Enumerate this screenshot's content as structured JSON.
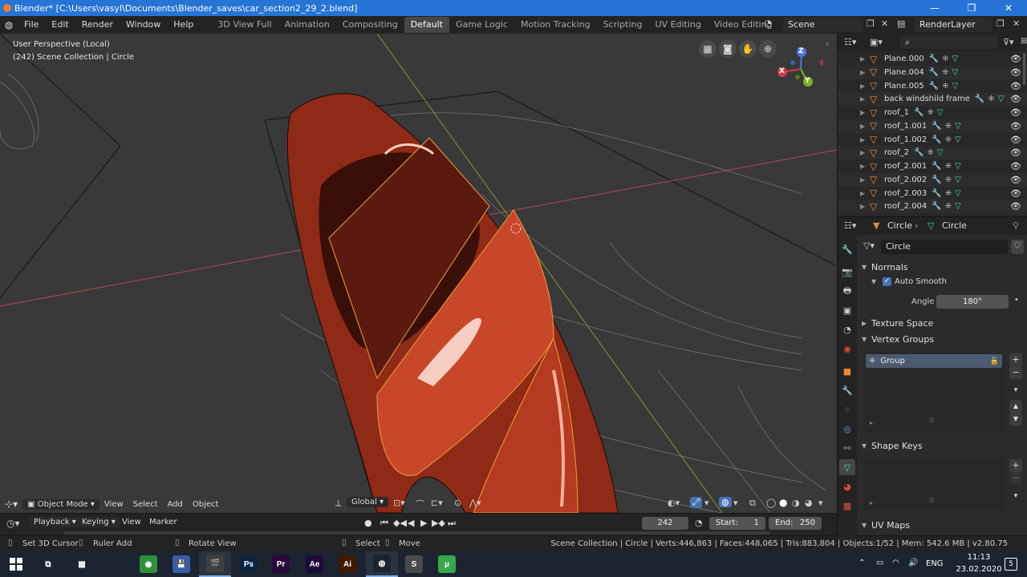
{
  "window": {
    "title": "Blender* [C:\\Users\\vasyl\\Documents\\Blender_saves\\car_section2_29_2.blend]",
    "min_glyph": "—",
    "max_glyph": "❐",
    "close_glyph": "✕"
  },
  "menu": {
    "items": [
      "File",
      "Edit",
      "Render",
      "Window",
      "Help"
    ]
  },
  "workspaces": {
    "tabs": [
      "3D View Full",
      "Animation",
      "Compositing",
      "Default",
      "Game Logic",
      "Motion Tracking",
      "Scripting",
      "UV Editing",
      "Video Editing"
    ],
    "active": "Default",
    "add_glyph": "+"
  },
  "scene": {
    "name": "Scene",
    "render_layer": "RenderLayer"
  },
  "viewport": {
    "perspective": "User Perspective (Local)",
    "collection_info": "(242) Scene Collection | Circle",
    "gizmo": {
      "x": "X",
      "y": "Y",
      "z": "Z"
    }
  },
  "viewport_header": {
    "mode": "Object Mode",
    "menus": [
      "View",
      "Select",
      "Add",
      "Object"
    ],
    "orientation": "Global"
  },
  "timeline": {
    "menus": [
      "Playback",
      "Keying",
      "View",
      "Marker"
    ],
    "current_frame": "242",
    "start_label": "Start:",
    "start": "1",
    "end_label": "End:",
    "end": "250"
  },
  "statusbar": {
    "hints": [
      "Set 3D Cursor",
      "Ruler Add",
      "Rotate View",
      "Select",
      "Move"
    ],
    "stats": "Scene Collection | Circle | Verts:446,863 | Faces:448,065 | Tris:883,804 | Objects:1/52 | Mem: 542.6 MB | v2.80.75"
  },
  "outliner": {
    "search_placeholder": "",
    "items": [
      {
        "name": "Plane.000",
        "mesh_data": true
      },
      {
        "name": "Plane.004",
        "mesh_data": true
      },
      {
        "name": "Plane.005",
        "mesh_data": true
      },
      {
        "name": "back windshild frame",
        "mesh_data": true
      },
      {
        "name": "roof_1",
        "mesh_data": false
      },
      {
        "name": "roof_1.001",
        "mesh_data": false
      },
      {
        "name": "roof_1.002",
        "mesh_data": true
      },
      {
        "name": "roof_2",
        "mesh_data": false
      },
      {
        "name": "roof_2.001",
        "mesh_data": true
      },
      {
        "name": "roof_2.002",
        "mesh_data": true
      },
      {
        "name": "roof_2.003",
        "mesh_data": true
      },
      {
        "name": "roof_2.004",
        "mesh_data": true
      }
    ]
  },
  "properties": {
    "object_name": "Circle",
    "data_name": "Circle",
    "mesh_field": "Circle",
    "normals": {
      "header": "Normals",
      "auto_smooth_label": "Auto Smooth",
      "auto_smooth": true,
      "angle_label": "Angle",
      "angle": "180°"
    },
    "texture_space": "Texture Space",
    "vertex_groups": {
      "header": "Vertex Groups",
      "items": [
        "Group"
      ]
    },
    "shape_keys": "Shape Keys",
    "uv_maps": "UV Maps"
  },
  "taskbar": {
    "language": "ENG",
    "time": "11:13",
    "date": "23.02.2020",
    "notif_count": "5",
    "apps": [
      {
        "name": "task-view",
        "label": "⧉",
        "color": "#1b2430"
      },
      {
        "name": "calculator",
        "label": "▦",
        "color": "#1b2430"
      },
      {
        "name": "chrome",
        "label": "◉",
        "color": "#2f8f3a"
      },
      {
        "name": "save-app",
        "label": "💾",
        "color": "#3b5aa8"
      },
      {
        "name": "clapper",
        "label": "🎬",
        "color": "#404040"
      },
      {
        "name": "photoshop",
        "label": "Ps",
        "color": "#0a2540"
      },
      {
        "name": "premiere",
        "label": "Pr",
        "color": "#2a0a3d"
      },
      {
        "name": "after-effects",
        "label": "Ae",
        "color": "#1f0a3d"
      },
      {
        "name": "illustrator",
        "label": "Ai",
        "color": "#3d1a00"
      },
      {
        "name": "blender",
        "label": "◍",
        "color": "#1b2430"
      },
      {
        "name": "sublime",
        "label": "S",
        "color": "#4a4a4a"
      },
      {
        "name": "utorrent",
        "label": "µ",
        "color": "#3aa64b"
      }
    ]
  },
  "colors": {
    "accent": "#2674d6",
    "object_orange": "#e88a36",
    "mesh_green": "#44d8a0",
    "modifier_blue": "#6d9bd5",
    "car_red": "#c8472a",
    "selection_outline": "#f0a030"
  }
}
